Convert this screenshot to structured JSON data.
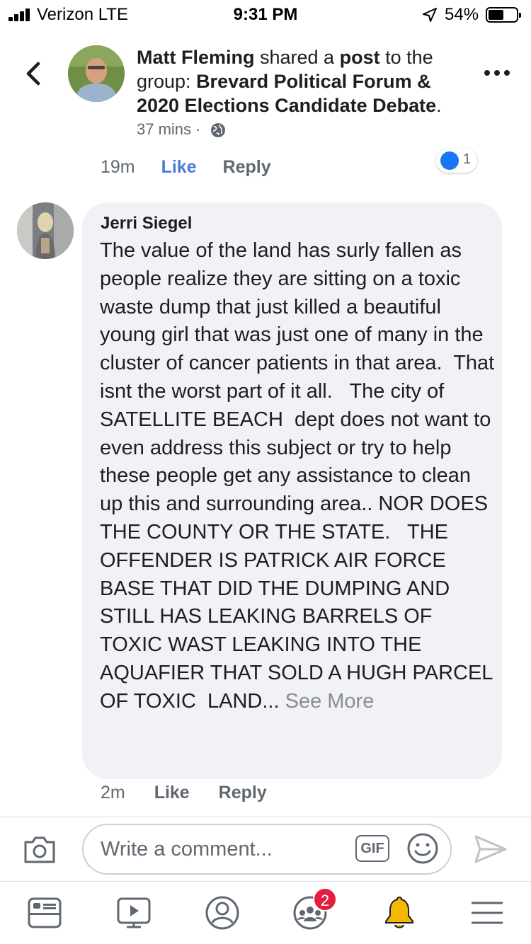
{
  "status_bar": {
    "carrier": "Verizon  LTE",
    "time": "9:31 PM",
    "battery": "54%",
    "battery_level": 0.54
  },
  "post_header": {
    "author": "Matt Fleming",
    "action_1": " shared a ",
    "object": "post",
    "action_2": " to the group: ",
    "group": "Brevard Political Forum & 2020 Elections Candidate Debate",
    "group_suffix": ".",
    "time": "37 mins",
    "separator": "·",
    "privacy_icon": "globe-icon"
  },
  "previous_comment": {
    "time": "19m",
    "like": "Like",
    "reply": "Reply",
    "reaction_count": "1"
  },
  "comment": {
    "author": "Jerri Siegel",
    "text": "The value of the land has surly fallen as people realize they are sitting on a toxic waste dump that just killed a beautiful young girl that was just one of many in the cluster of cancer patients in that area.  That isnt the worst part of it all.   The city of SATELLITE BEACH  dept does not want to even address this subject or try to help these people get any assistance to clean up this and surrounding area.. NOR DOES THE COUNTY OR THE STATE.   THE OFFENDER IS PATRICK AIR FORCE BASE THAT DID THE DUMPING AND STILL HAS LEAKING BARRELS OF TOXIC WAST LEAKING INTO THE AQUAFIER THAT SOLD A HUGH PARCEL OF TOXIC  LAND...",
    "see_more": "See More",
    "time": "2m",
    "like": "Like",
    "reply": "Reply"
  },
  "composer": {
    "placeholder": "Write a comment...",
    "gif": "GIF"
  },
  "bottom_nav": {
    "items": [
      "news-feed-icon",
      "watch-icon",
      "profile-icon",
      "groups-icon",
      "notifications-icon",
      "menu-icon"
    ],
    "groups_badge": "2"
  },
  "colors": {
    "link_blue": "#4a7ad8",
    "bubble_bg": "#f0f2f5",
    "badge_red": "#e41e3f",
    "bell_yellow": "#f5b800"
  }
}
